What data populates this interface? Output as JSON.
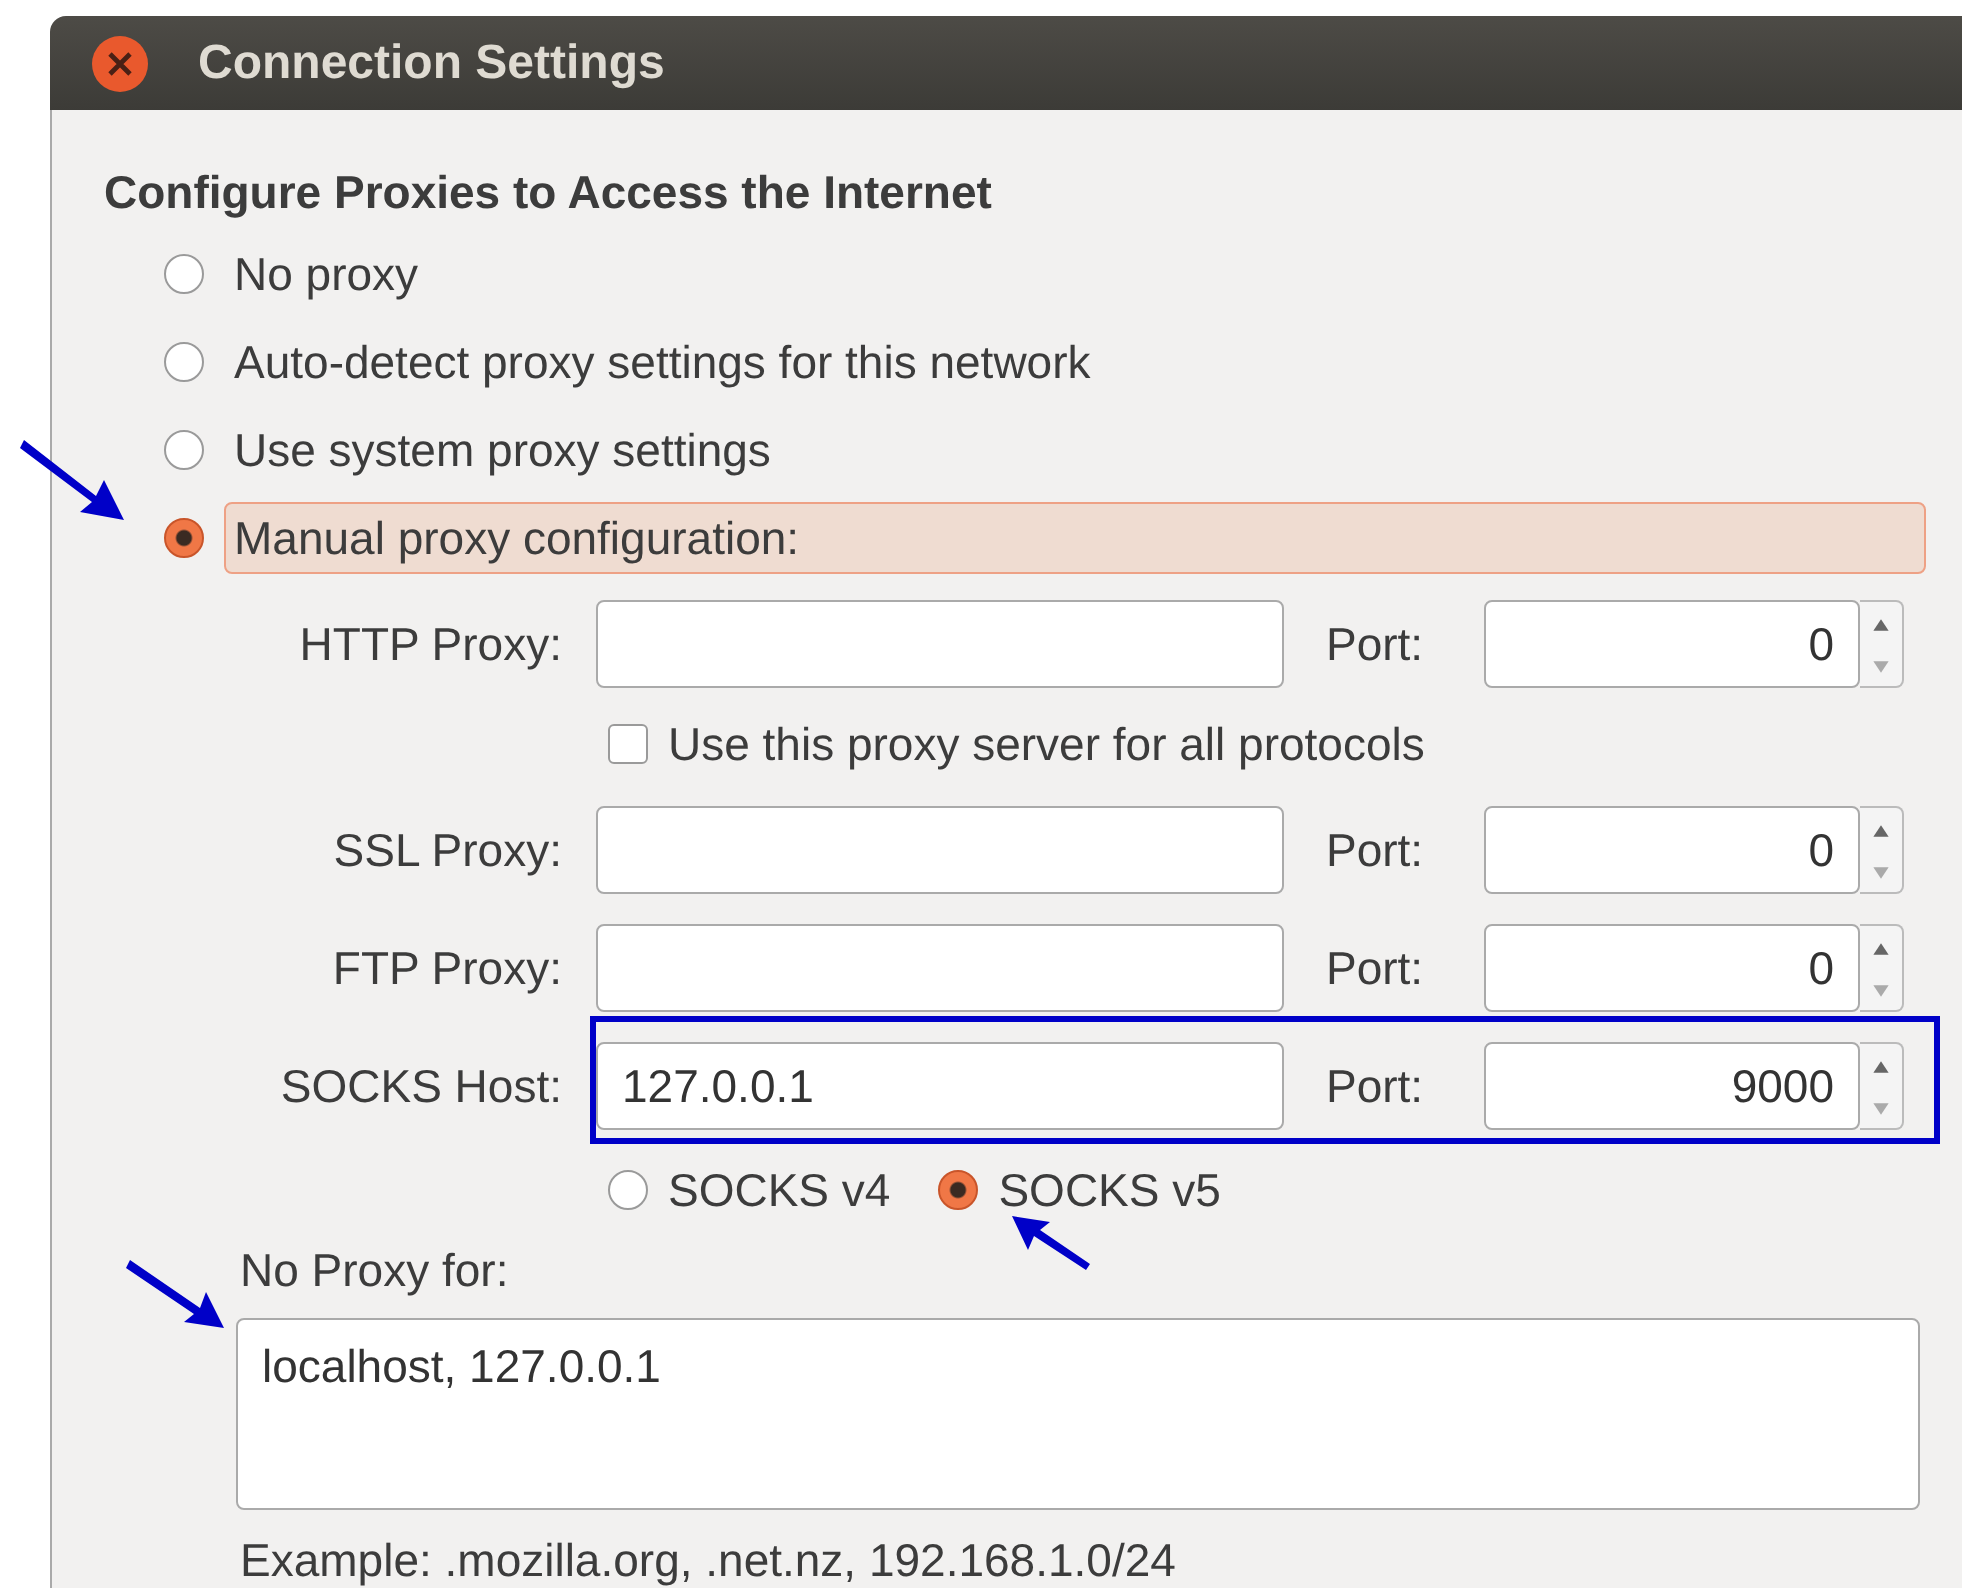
{
  "window": {
    "title": "Connection Settings"
  },
  "heading": "Configure Proxies to Access the Internet",
  "proxy_modes": [
    {
      "label": "No proxy",
      "selected": false
    },
    {
      "label": "Auto-detect proxy settings for this network",
      "selected": false
    },
    {
      "label": "Use system proxy settings",
      "selected": false
    },
    {
      "label": "Manual proxy configuration:",
      "selected": true
    }
  ],
  "manual_rows": [
    {
      "kind": "proxy",
      "label": "HTTP Proxy:",
      "port_label": "Port:",
      "port": "0",
      "highlighted": false
    },
    {
      "kind": "checkbox",
      "label": "Use this proxy server for all protocols",
      "checked": false
    },
    {
      "kind": "proxy",
      "label": "SSL Proxy:",
      "port_label": "Port:",
      "port": "0",
      "highlighted": false
    },
    {
      "kind": "proxy",
      "label": "FTP Proxy:",
      "port_label": "Port:",
      "port": "0",
      "highlighted": false
    },
    {
      "kind": "proxy",
      "label": "SOCKS Host:",
      "value": "127.0.0.1",
      "port_label": "Port:",
      "port": "9000",
      "highlighted": true
    }
  ],
  "socks_versions": [
    {
      "label": "SOCKS v4",
      "selected": false
    },
    {
      "label": "SOCKS v5",
      "selected": true
    }
  ],
  "no_proxy": {
    "label": "No Proxy for:",
    "value": "localhost, 127.0.0.1",
    "example": "Example: .mozilla.org, .net.nz, 192.168.1.0/24"
  }
}
